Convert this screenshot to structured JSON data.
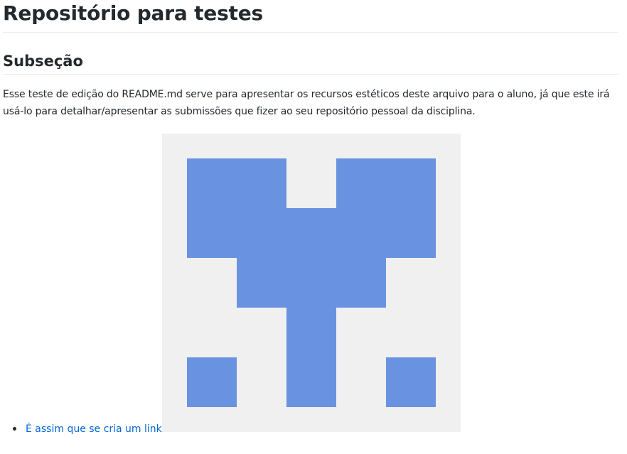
{
  "readme": {
    "title": "Repositório para testes",
    "subsection_title": "Subseção",
    "paragraph": "Esse teste de edição do README.md serve para apresentar os recursos estéticos deste arquivo para o aluno, já que este irá usá-lo para detalhar/apresentar as submissões que fizer ao seu repositório pessoal da disciplina.",
    "link_label": "É assim que se cria um link"
  },
  "colors": {
    "identicon_fill": "#6993e0",
    "identicon_background": "#f0f0f0",
    "link": "#0366d6",
    "text": "#24292e"
  },
  "icons": {
    "identicon": "identicon-image"
  }
}
